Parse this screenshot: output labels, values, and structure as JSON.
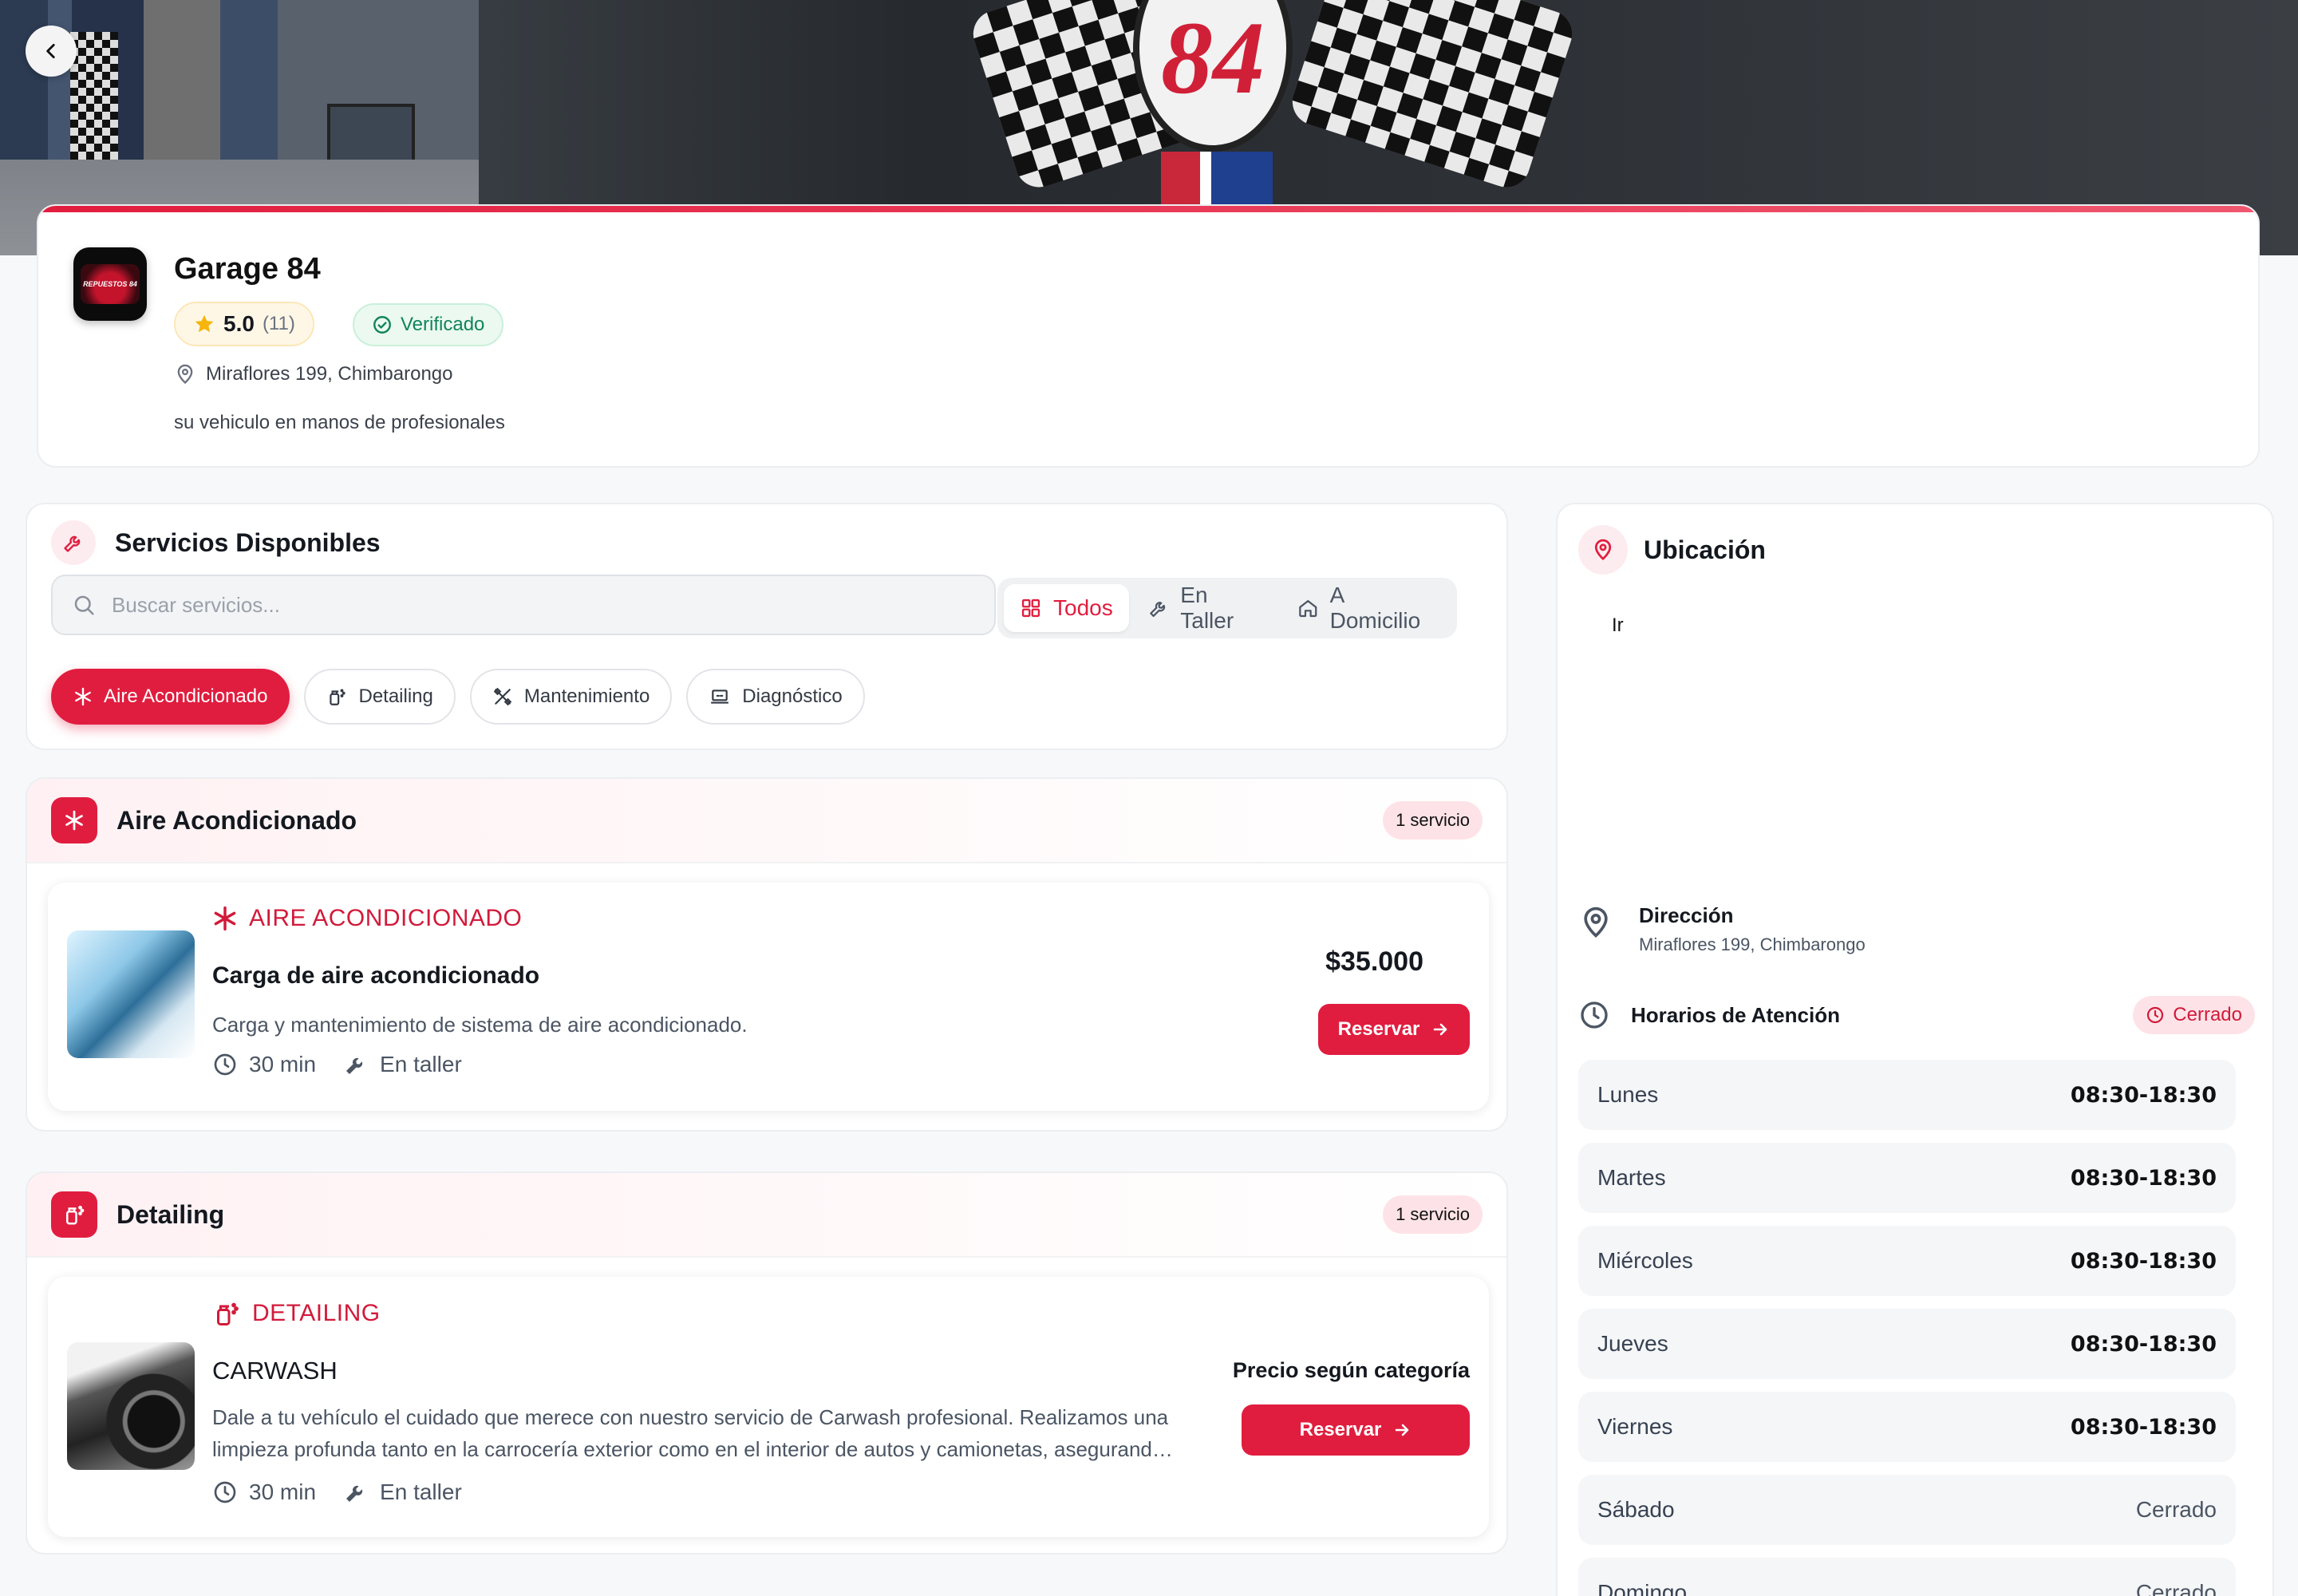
{
  "shop": {
    "name": "Garage 84",
    "rating": "5.0",
    "rating_count": "(11)",
    "verified_label": "Verificado",
    "address": "Miraflores 199, Chimbarongo",
    "tagline": "su vehiculo en manos de profesionales",
    "logo_text": "REPUESTOS 84",
    "hero_text": "84"
  },
  "services_panel": {
    "title": "Servicios Disponibles",
    "search_placeholder": "Buscar servicios...",
    "filters": [
      "Todos",
      "En Taller",
      "A Domicilio"
    ],
    "active_filter": "Todos",
    "chips": [
      "Aire Acondicionado",
      "Detailing",
      "Mantenimiento",
      "Diagnóstico"
    ],
    "active_chip": "Aire Acondicionado"
  },
  "categories": [
    {
      "title": "Aire Acondicionado",
      "count": "1 servicio",
      "service": {
        "category": "AIRE ACONDICIONADO",
        "name": "Carga de aire acondicionado",
        "description": "Carga y mantenimiento de sistema de aire acondicionado.",
        "duration": "30 min",
        "location": "En taller",
        "price": "$35.000",
        "button": "Reservar"
      }
    },
    {
      "title": "Detailing",
      "count": "1 servicio",
      "service": {
        "category": "DETAILING",
        "name": "CARWASH",
        "description_line1": "Dale a tu vehículo el cuidado que merece con nuestro servicio de Carwash profesional. Realizamos una",
        "description_line2": "limpieza profunda tanto en la carrocería exterior como en el interior de autos y camionetas, asegurand…",
        "duration": "30 min",
        "location": "En taller",
        "price": "Precio según categoría",
        "button": "Reservar"
      }
    }
  ],
  "location_panel": {
    "title": "Ubicación",
    "map_link": "Ir",
    "address_label": "Dirección",
    "address": "Miraflores 199, Chimbarongo",
    "hours_title": "Horarios de Atención",
    "status": "Cerrado",
    "hours": [
      {
        "day": "Lunes",
        "time": "08:30-18:30"
      },
      {
        "day": "Martes",
        "time": "08:30-18:30"
      },
      {
        "day": "Miércoles",
        "time": "08:30-18:30"
      },
      {
        "day": "Jueves",
        "time": "08:30-18:30"
      },
      {
        "day": "Viernes",
        "time": "08:30-18:30"
      },
      {
        "day": "Sábado",
        "time": "Cerrado"
      },
      {
        "day": "Domingo",
        "time": "Cerrado"
      }
    ]
  },
  "colors": {
    "accent": "#e11d3f",
    "verified": "#11845b",
    "star": "#f5b50b"
  },
  "icons": {
    "back": "chevron-left-icon",
    "star": "star-icon",
    "verified": "check-circle-icon",
    "pin": "map-pin-icon",
    "wrench": "wrench-icon",
    "search": "search-icon",
    "grid": "grid-icon",
    "home": "home-icon",
    "snowflake": "snowflake-icon",
    "spray": "spray-bottle-icon",
    "tools": "tools-icon",
    "laptop": "laptop-icon",
    "clock": "clock-icon",
    "arrow": "arrow-right-icon"
  }
}
